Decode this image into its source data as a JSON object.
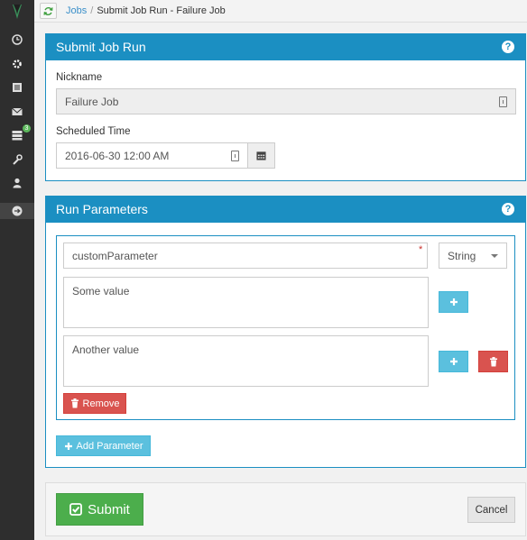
{
  "breadcrumb": {
    "jobs_link": "Jobs",
    "separator": "/",
    "current": "Submit Job Run - Failure Job"
  },
  "sidebar": {
    "icons": [
      "clock-icon",
      "gear-icon",
      "list-icon",
      "envelope-icon",
      "server-icon",
      "wrench-icon",
      "user-icon",
      "arrow-circle-icon"
    ],
    "badge": "3"
  },
  "submit_panel": {
    "title": "Submit Job Run",
    "nickname_label": "Nickname",
    "nickname_value": "Failure Job",
    "scheduled_label": "Scheduled Time",
    "scheduled_value": "2016-06-30 12:00 AM"
  },
  "params_panel": {
    "title": "Run Parameters",
    "param_name": "customParameter",
    "required_mark": "*",
    "type_selected": "String",
    "values": [
      "Some value",
      "Another value"
    ],
    "remove_label": "Remove",
    "add_param_label": "Add Parameter"
  },
  "footer": {
    "submit_label": "Submit",
    "cancel_label": "Cancel"
  },
  "colors": {
    "primary": "#1b8fc2",
    "info": "#5bc0de",
    "danger": "#d9534f",
    "success": "#4cae4c",
    "sidebar": "#2e2e2e"
  }
}
